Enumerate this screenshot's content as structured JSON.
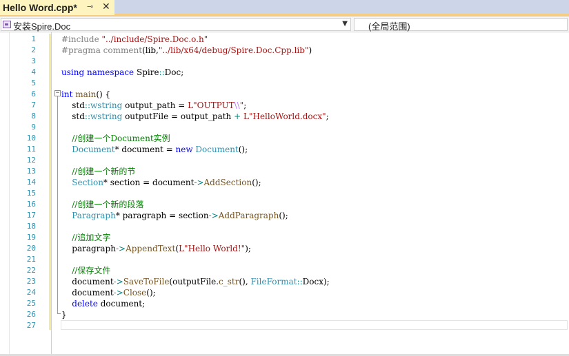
{
  "tab": {
    "title": "Hello Word.cpp*",
    "pin_glyph": "⊸",
    "close_glyph": "✕"
  },
  "navbar": {
    "scope_label": "安装Spire.Doc",
    "member_label": "(全局范围)",
    "dropdown_glyph": "▼"
  },
  "editor": {
    "line_numbers": [
      "1",
      "2",
      "3",
      "4",
      "5",
      "6",
      "7",
      "8",
      "9",
      "10",
      "11",
      "12",
      "13",
      "14",
      "15",
      "16",
      "17",
      "18",
      "19",
      "20",
      "21",
      "22",
      "23",
      "24",
      "25",
      "26",
      "27"
    ],
    "collapse_glyph": "−",
    "lines": [
      [
        {
          "t": "#include ",
          "c": "pp"
        },
        {
          "t": "\"../include/Spire.Doc.o.h\"",
          "c": "str"
        }
      ],
      [
        {
          "t": "#pragma comment",
          "c": "pp"
        },
        {
          "t": "(lib,",
          "c": "pl"
        },
        {
          "t": "\"../lib/x64/debug/Spire.Doc.Cpp.lib\"",
          "c": "str"
        },
        {
          "t": ")",
          "c": "pl"
        }
      ],
      [],
      [
        {
          "t": "using",
          "c": "kw"
        },
        {
          "t": " ",
          "c": "pl"
        },
        {
          "t": "namespace",
          "c": "kw"
        },
        {
          "t": " Spire",
          "c": "pl"
        },
        {
          "t": "::",
          "c": "op"
        },
        {
          "t": "Doc;",
          "c": "pl"
        }
      ],
      [],
      [
        {
          "t": "int",
          "c": "kw"
        },
        {
          "t": " ",
          "c": "pl"
        },
        {
          "t": "main",
          "c": "fn"
        },
        {
          "t": "() {",
          "c": "pl"
        }
      ],
      [
        {
          "t": "    std",
          "c": "pl"
        },
        {
          "t": "::",
          "c": "op"
        },
        {
          "t": "wstring",
          "c": "ty"
        },
        {
          "t": " output_path = ",
          "c": "pl"
        },
        {
          "t": "L\"OUTPUT",
          "c": "str"
        },
        {
          "t": "\\\\",
          "c": "esc"
        },
        {
          "t": "\"",
          "c": "str"
        },
        {
          "t": ";",
          "c": "pl"
        }
      ],
      [
        {
          "t": "    std",
          "c": "pl"
        },
        {
          "t": "::",
          "c": "op"
        },
        {
          "t": "wstring",
          "c": "ty"
        },
        {
          "t": " outputFile = output_path ",
          "c": "pl"
        },
        {
          "t": "+",
          "c": "op"
        },
        {
          "t": " ",
          "c": "pl"
        },
        {
          "t": "L\"HelloWorld.docx\"",
          "c": "str"
        },
        {
          "t": ";",
          "c": "pl"
        }
      ],
      [],
      [
        {
          "t": "    //创建一个Document实例",
          "c": "cm"
        }
      ],
      [
        {
          "t": "    ",
          "c": "pl"
        },
        {
          "t": "Document",
          "c": "ty"
        },
        {
          "t": "* document = ",
          "c": "pl"
        },
        {
          "t": "new",
          "c": "kw"
        },
        {
          "t": " ",
          "c": "pl"
        },
        {
          "t": "Document",
          "c": "ty"
        },
        {
          "t": "();",
          "c": "pl"
        }
      ],
      [],
      [
        {
          "t": "    //创建一个新的节",
          "c": "cm"
        }
      ],
      [
        {
          "t": "    ",
          "c": "pl"
        },
        {
          "t": "Section",
          "c": "ty"
        },
        {
          "t": "* section = document",
          "c": "pl"
        },
        {
          "t": "->",
          "c": "op"
        },
        {
          "t": "AddSection",
          "c": "fn"
        },
        {
          "t": "();",
          "c": "pl"
        }
      ],
      [],
      [
        {
          "t": "    //创建一个新的段落",
          "c": "cm"
        }
      ],
      [
        {
          "t": "    ",
          "c": "pl"
        },
        {
          "t": "Paragraph",
          "c": "ty"
        },
        {
          "t": "* paragraph = section",
          "c": "pl"
        },
        {
          "t": "->",
          "c": "op"
        },
        {
          "t": "AddParagraph",
          "c": "fn"
        },
        {
          "t": "();",
          "c": "pl"
        }
      ],
      [],
      [
        {
          "t": "    //追加文字",
          "c": "cm"
        }
      ],
      [
        {
          "t": "    paragraph",
          "c": "pl"
        },
        {
          "t": "->",
          "c": "op"
        },
        {
          "t": "AppendText",
          "c": "fn"
        },
        {
          "t": "(",
          "c": "pl"
        },
        {
          "t": "L\"Hello World!\"",
          "c": "str"
        },
        {
          "t": ");",
          "c": "pl"
        }
      ],
      [],
      [
        {
          "t": "    //保存文件",
          "c": "cm"
        }
      ],
      [
        {
          "t": "    document",
          "c": "pl"
        },
        {
          "t": "->",
          "c": "op"
        },
        {
          "t": "SaveToFile",
          "c": "fn"
        },
        {
          "t": "(outputFile.",
          "c": "pl"
        },
        {
          "t": "c_str",
          "c": "fn"
        },
        {
          "t": "(), ",
          "c": "pl"
        },
        {
          "t": "FileFormat",
          "c": "ty"
        },
        {
          "t": "::",
          "c": "op"
        },
        {
          "t": "Docx);",
          "c": "pl"
        }
      ],
      [
        {
          "t": "    document",
          "c": "pl"
        },
        {
          "t": "->",
          "c": "op"
        },
        {
          "t": "Close",
          "c": "fn"
        },
        {
          "t": "();",
          "c": "pl"
        }
      ],
      [
        {
          "t": "    ",
          "c": "pl"
        },
        {
          "t": "delete",
          "c": "kw"
        },
        {
          "t": " document;",
          "c": "pl"
        }
      ],
      [
        {
          "t": "}",
          "c": "pl"
        }
      ],
      []
    ]
  },
  "colors": {
    "tab_active": "#fdf4bf",
    "tab_bar": "#cdd6e8",
    "keyword": "#0000ff",
    "string": "#a31515",
    "type": "#2b91af",
    "comment": "#008000",
    "preprocessor": "#808080",
    "function": "#74531f",
    "line_number": "#2b91af"
  },
  "icons": {
    "scope": "class-scope-icon",
    "pin": "pin-icon",
    "close": "close-icon",
    "dropdown": "chevron-down-icon",
    "outline": "collapse-icon"
  }
}
